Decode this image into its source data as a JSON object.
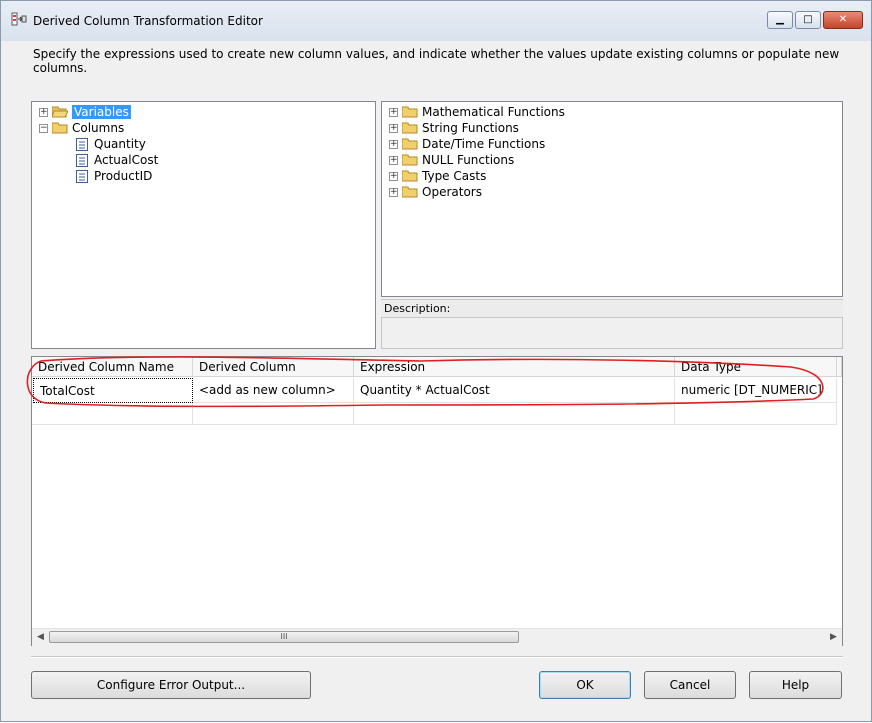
{
  "window": {
    "title": "Derived Column Transformation Editor",
    "description": "Specify the expressions used to create new column values, and indicate whether the values update existing columns or populate new columns."
  },
  "left_tree": {
    "variables": "Variables",
    "columns": "Columns",
    "column_items": [
      "Quantity",
      "ActualCost",
      "ProductID"
    ]
  },
  "right_tree": {
    "items": [
      "Mathematical Functions",
      "String Functions",
      "Date/Time Functions",
      "NULL Functions",
      "Type Casts",
      "Operators"
    ]
  },
  "description_label": "Description:",
  "grid": {
    "headers": [
      "Derived Column Name",
      "Derived Column",
      "Expression",
      "Data Type"
    ],
    "row": {
      "name": "TotalCost",
      "derived_column": "<add as new column>",
      "expression": "Quantity * ActualCost",
      "data_type": "numeric [DT_NUMERIC]"
    },
    "scroll_grip": "III"
  },
  "buttons": {
    "configure_error_output": "Configure Error Output...",
    "ok": "OK",
    "cancel": "Cancel",
    "help": "Help"
  },
  "colors": {
    "annotation": "#e02020",
    "selection": "#3399ff"
  }
}
